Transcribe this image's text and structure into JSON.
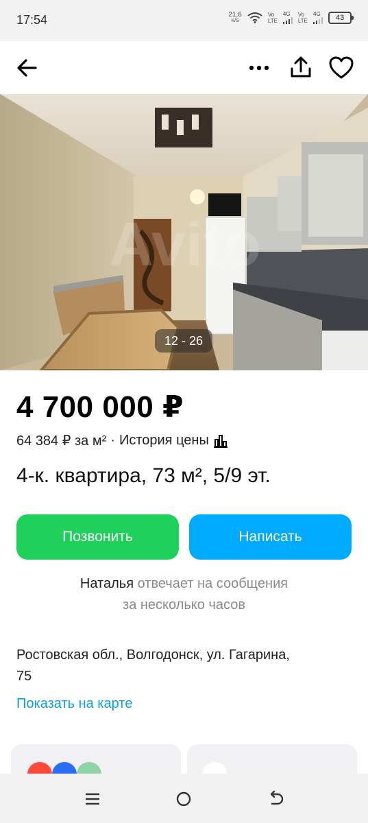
{
  "status_bar": {
    "time": "17:54",
    "net_speed": "21,6",
    "net_speed_unit": "K/S",
    "sim1_label_top": "Vo",
    "sim1_label_bottom": "LTE",
    "sim1_type": "4G",
    "sim2_label_top": "Vo",
    "sim2_label_bottom": "LTE",
    "sim2_type": "4G",
    "battery": "43"
  },
  "top_bar": {
    "icons": [
      "back-arrow-icon",
      "more-icon",
      "share-icon",
      "heart-icon"
    ]
  },
  "gallery": {
    "counter": "12 - 26"
  },
  "listing": {
    "price": "4 700 000 ₽",
    "price_per_m2": "64 384 ₽ за м²",
    "separator": "·",
    "price_history": "История цены",
    "title": "4-к. квартира, 73 м², 5/9 эт."
  },
  "actions": {
    "call": "Позвонить",
    "message": "Написать",
    "call_color": "#1fd15b",
    "message_color": "#00abff"
  },
  "seller_info": {
    "name": "Наталья",
    "reply_line1": "отвечает на сообщения",
    "reply_line2": "за несколько часов"
  },
  "location": {
    "address_line1": "Ростовская обл., Волгодонск, ул. Гагарина,",
    "address_line2": "75",
    "map_link": "Показать на карте"
  },
  "colors": {
    "link": "#0aa0e6"
  }
}
